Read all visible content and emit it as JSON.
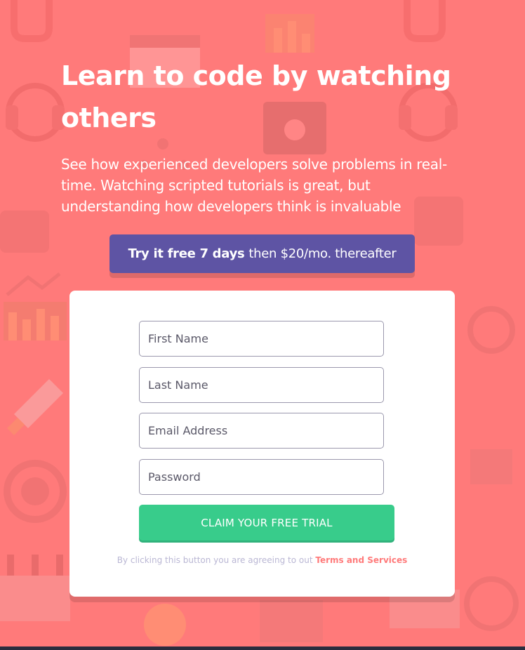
{
  "page": {
    "background_color": "#ff7a7a",
    "accent_purple": "#5e54a4",
    "accent_green": "#38cc8b"
  },
  "hero": {
    "headline": "Learn to code by watching others",
    "subtext": "See how experienced developers solve problems in real-time. Watching scripted tutorials is great, but understanding how developers think is invaluable"
  },
  "promo": {
    "bold_text": "Try it free 7 days",
    "rest_text": "then $20/mo. thereafter"
  },
  "form": {
    "first_name_placeholder": "First Name",
    "last_name_placeholder": "Last Name",
    "email_placeholder": "Email Address",
    "password_placeholder": "Password",
    "submit_label": "CLAIM YOUR FREE TRIAL",
    "terms_prefix": "By clicking this button you are agreeing to out",
    "terms_link": "Terms and Services"
  },
  "icons": {
    "background_pattern": "developer-illustration-pattern"
  }
}
